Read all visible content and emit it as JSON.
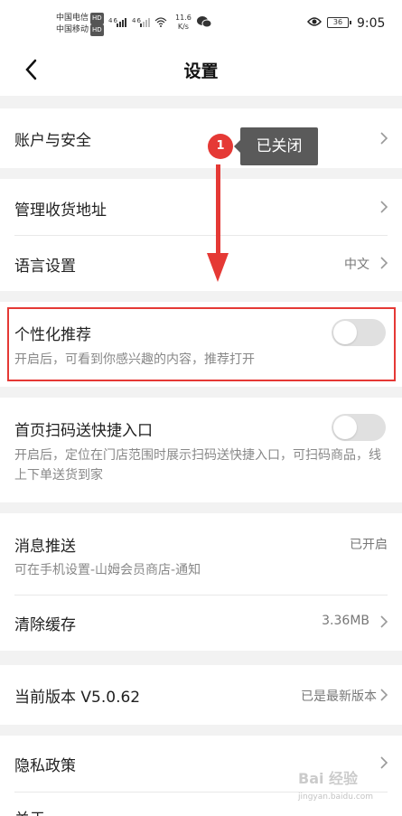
{
  "status_bar": {
    "carrier1": "中国电信",
    "carrier2": "中国移动",
    "hd": "HD",
    "signal": "⁴⁶▮▮▮ ⁴⁶▮▮",
    "speed_value": "11.6",
    "speed_unit": "K/s",
    "battery": "36",
    "time": "9:05"
  },
  "nav": {
    "title": "设置"
  },
  "rows": {
    "account": {
      "label": "账户与安全"
    },
    "address": {
      "label": "管理收货地址"
    },
    "language": {
      "label": "语言设置",
      "value": "中文"
    },
    "personal": {
      "label": "个性化推荐",
      "desc": "开启后，可看到你感兴趣的内容，推荐打开"
    },
    "scan": {
      "label": "首页扫码送快捷入口",
      "desc": "开启后，定位在门店范围时展示扫码送快捷入口，可扫码商品，线上下单送货到家"
    },
    "push": {
      "label": "消息推送",
      "value": "已开启",
      "desc": "可在手机设置-山姆会员商店-通知"
    },
    "cache": {
      "label": "清除缓存",
      "value": "3.36MB"
    },
    "version": {
      "label": "当前版本 V5.0.62",
      "value": "已是最新版本"
    },
    "privacy": {
      "label": "隐私政策"
    },
    "about": {
      "label": "关于"
    }
  },
  "annotation": {
    "badge": "1",
    "tooltip": "已关闭"
  },
  "watermark": {
    "text": "Bai 经验",
    "sub": "jingyan.baidu.com"
  },
  "colors": {
    "accent_red": "#e53935",
    "toggle_off": "#e0e0e0"
  }
}
